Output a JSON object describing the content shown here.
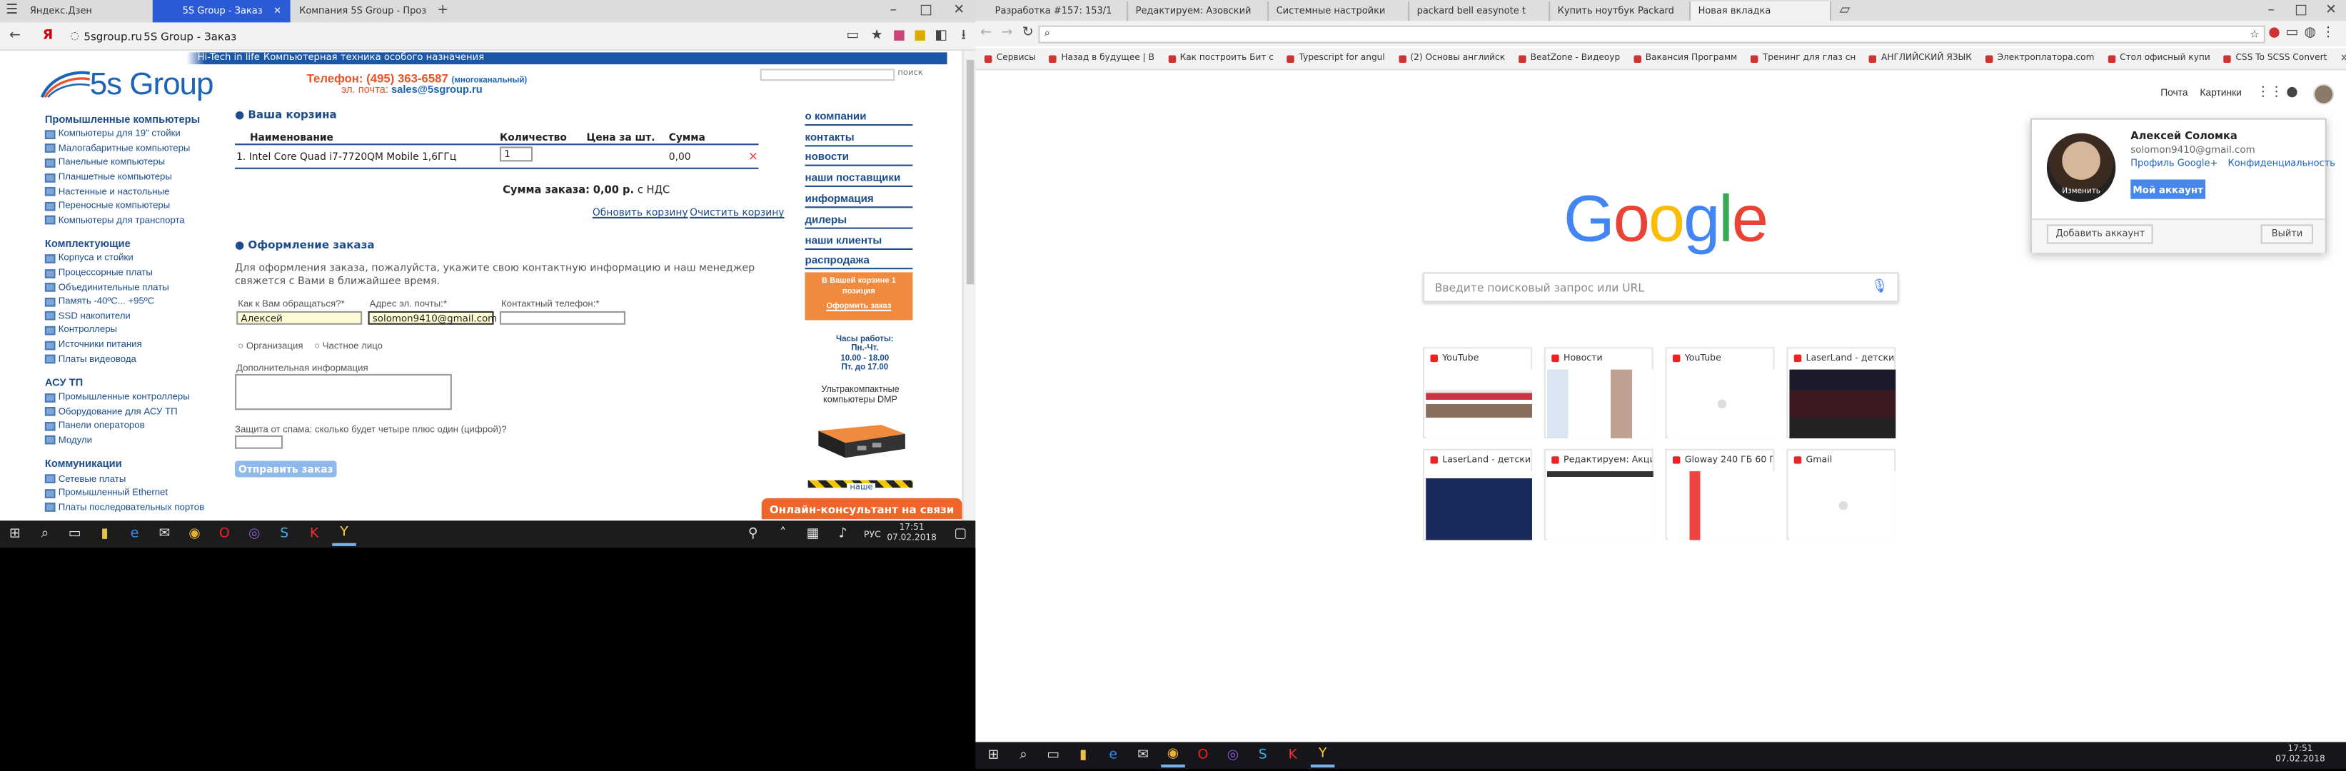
{
  "left": {
    "browser_tabs": [
      "Яндекс.Дзен",
      "5S Group - Заказ",
      "Компания 5S Group - Проз"
    ],
    "address": {
      "domain": "5sgroup.ru",
      "title": "5S Group - Заказ"
    },
    "site": {
      "topbar_left": "Hi-Tech in life",
      "topbar_right": "Компьютерная техника особого назначения",
      "logo": "5s Group",
      "phone_label": "Телефон: (495) 363-6587",
      "phone_note": "(многоканальный)",
      "email_label": "эл. почта:",
      "email_value": "sales@5sgroup.ru",
      "search_label": "поиск",
      "left_nav": [
        {
          "heading": "Промышленные компьютеры",
          "items": [
            "Компьютеры для 19\" стойки",
            "Малогабаритные компьютеры",
            "Панельные компьютеры",
            "Планшетные компьютеры",
            "Настенные и настольные",
            "Переносные компьютеры",
            "Компьютеры для транспорта"
          ]
        },
        {
          "heading": "Комплектующие",
          "items": [
            "Корпуса и стойки",
            "Процессорные платы",
            "Объединительные платы",
            "Память -40ºC... +95ºC",
            "SSD накопители",
            "Контроллеры",
            "Источники питания",
            "Платы видеовода"
          ]
        },
        {
          "heading": "АСУ ТП",
          "items": [
            "Промышленные контроллеры",
            "Оборудование для АСУ ТП",
            "Панели операторов",
            "Модули"
          ]
        },
        {
          "heading": "Коммуникации",
          "items": [
            "Сетевые платы",
            "Промышленный Ethernet",
            "Платы последовательных портов"
          ]
        }
      ],
      "cart": {
        "title": "Ваша корзина",
        "headers": [
          "Наименование",
          "Количество",
          "Цена за шт.",
          "Сумма"
        ],
        "row": {
          "name": "1. Intel Core Quad i7-7720QM Mobile 1,6ГГц",
          "qty": "1",
          "sum": "0,00",
          "remove": "×"
        },
        "total_label": "Сумма заказа:",
        "total_value": "0,00 р.",
        "total_note": "с НДС",
        "update_link": "Обновить корзину",
        "clear_link": "Очистить корзину"
      },
      "order": {
        "title": "Оформление заказа",
        "intro": "Для оформления заказа, пожалуйста, укажите свою контактную информацию и наш менеджер свяжется с Вами в ближайшее время.",
        "name_label": "Как к Вам обращаться?*",
        "name_value": "Алексей",
        "email_label": "Адрес эл. почты:*",
        "email_value": "solomon9410@gmail.com",
        "phone_label": "Контактный телефон:*",
        "radio_org": "Организация",
        "radio_person": "Частное лицо",
        "extra_label": "Дополнительная информация",
        "spam_label": "Защита от спама: сколько будет четыре плюс один (цифрой)?",
        "submit": "Отправить заказ"
      },
      "right_nav": [
        "о компании",
        "контакты",
        "новости",
        "наши поставщики",
        "информация",
        "дилеры",
        "наши клиенты",
        "распродажа"
      ],
      "cart_box": {
        "line1": "В Вашей корзине 1 позиция",
        "link": "Оформить заказ"
      },
      "hours": {
        "title": "Часы работы:",
        "days": "Пн.-Чт.",
        "time": "10.00 - 18.00",
        "friday": "Пт. до 17.00"
      },
      "promo": "Ультракомпактные компьютеры DMP",
      "promo2": "наше",
      "consult": "Онлайн-консультант на связи"
    },
    "taskbar": {
      "time": "17:51",
      "date": "07.02.2018",
      "lang": "РУС"
    }
  },
  "right": {
    "browser_tabs": [
      "Разработка #157: 153/1",
      "Редактируем: Азовский",
      "Системные настройки",
      "packard bell easynote t",
      "Купить ноутбук Packard",
      "Новая вкладка"
    ],
    "bookmarks": [
      "Сервисы",
      "Назад в будущее | В",
      "Как построить Бит с",
      "Typescript for angul",
      "(2) Основы английск",
      "BeatZone - Видеоур",
      "Вакансия Программ",
      "Тренинг для глаз сн",
      "АНГЛИЙСКИЙ ЯЗЫК",
      "Электроплатора.com",
      "Стол офисный купи",
      "CSS To SCSS Convert"
    ],
    "header_links": [
      "Почта",
      "Картинки"
    ],
    "search_placeholder": "Введите поисковый запрос или URL",
    "tiles": [
      "YouTube",
      "Новости",
      "YouTube",
      "LaserLand - детски...",
      "LaserLand - детски...",
      "Редактируем: Акци...",
      "Gloway 240 ГБ 60 Г...",
      "Gmail"
    ],
    "account": {
      "name": "Алексей Соломка",
      "email": "solomon9410@gmail.com",
      "profile_link": "Профиль Google+",
      "privacy_link": "Конфиденциальность",
      "my_account": "Мой аккаунт",
      "change": "Изменить",
      "add_account": "Добавить аккаунт",
      "sign_out": "Выйти"
    },
    "taskbar": {
      "time": "17:51",
      "date": "07.02.2018"
    }
  }
}
